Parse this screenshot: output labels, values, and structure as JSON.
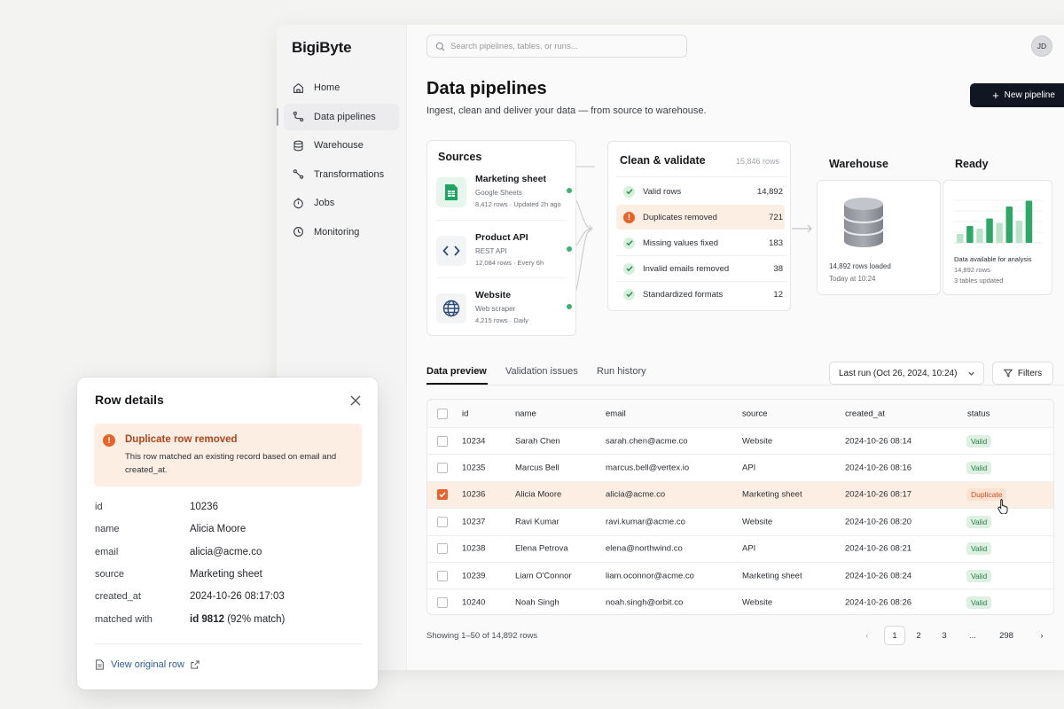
{
  "app": {
    "name": "BigiByte"
  },
  "nav": [
    {
      "label": "Home",
      "icon": "home-icon"
    },
    {
      "label": "Data pipelines",
      "icon": "pipeline-icon",
      "active": true
    },
    {
      "label": "Warehouse",
      "icon": "database-icon"
    },
    {
      "label": "Transformations",
      "icon": "transform-icon"
    },
    {
      "label": "Jobs",
      "icon": "jobs-icon"
    },
    {
      "label": "Monitoring",
      "icon": "monitoring-icon"
    }
  ],
  "search": {
    "placeholder": "Search pipelines, tables, or runs..."
  },
  "user": {
    "initials": "JD"
  },
  "page": {
    "title": "Data pipelines",
    "subtitle": "Ingest, clean and deliver your data — from source to warehouse.",
    "new_button": "New pipeline"
  },
  "sources": {
    "title": "Sources",
    "items": [
      {
        "name": "Marketing sheet",
        "type": "Google Sheets",
        "meta": "8,412 rows · Updated 2h ago",
        "icon": "sheets-icon"
      },
      {
        "name": "Product API",
        "type": "REST API",
        "meta": "12,084 rows · Every 6h",
        "icon": "code-icon"
      },
      {
        "name": "Website",
        "type": "Web scraper",
        "meta": "4,215 rows · Daily",
        "icon": "globe-icon"
      }
    ]
  },
  "clean": {
    "title": "Clean & validate",
    "count": "15,846 rows",
    "rows": [
      {
        "label": "Valid rows",
        "value": "14,892"
      },
      {
        "label": "Duplicates removed",
        "value": "721",
        "warn": true
      },
      {
        "label": "Missing values fixed",
        "value": "183"
      },
      {
        "label": "Invalid emails removed",
        "value": "38"
      },
      {
        "label": "Standardized formats",
        "value": "12"
      }
    ]
  },
  "warehouse": {
    "title": "Warehouse",
    "rows": "14,892 rows loaded",
    "time": "Today at 10:24"
  },
  "ready": {
    "title": "Ready",
    "line1": "Data available for analysis",
    "line2": "14,892 rows",
    "line3": "3 tables updated",
    "bars": [
      0.2,
      0.38,
      0.32,
      0.55,
      0.45,
      0.82,
      0.5,
      0.95
    ]
  },
  "tabs": [
    "Data preview",
    "Validation issues",
    "Run history"
  ],
  "run_select": "Last run (Oct 26, 2024, 10:24)",
  "filters_label": "Filters",
  "table": {
    "columns": [
      "id",
      "name",
      "email",
      "source",
      "created_at",
      "status"
    ],
    "rows": [
      [
        "10234",
        "Sarah Chen",
        "sarah.chen@acme.co",
        "Website",
        "2024-10-26 08:14",
        "Valid"
      ],
      [
        "10235",
        "Marcus Bell",
        "marcus.bell@vertex.io",
        "API",
        "2024-10-26 08:16",
        "Valid"
      ],
      [
        "10236",
        "Alicia Moore",
        "alicia@acme.co",
        "Marketing sheet",
        "2024-10-26 08:17",
        "Duplicate"
      ],
      [
        "10237",
        "Ravi Kumar",
        "ravi.kumar@acme.co",
        "Website",
        "2024-10-26 08:20",
        "Valid"
      ],
      [
        "10238",
        "Elena Petrova",
        "elena@northwind.co",
        "API",
        "2024-10-26 08:21",
        "Valid"
      ],
      [
        "10239",
        "Liam O'Connor",
        "liam.oconnor@acme.co",
        "Marketing sheet",
        "2024-10-26 08:24",
        "Valid"
      ],
      [
        "10240",
        "Noah Singh",
        "noah.singh@orbit.co",
        "Website",
        "2024-10-26 08:26",
        "Valid"
      ]
    ]
  },
  "footer": {
    "showing": "Showing 1–50 of 14,892 rows",
    "pages": [
      "1",
      "2",
      "3",
      "...",
      "298"
    ]
  },
  "details": {
    "title": "Row details",
    "alert_title": "Duplicate row removed",
    "alert_body": "This row matched an existing record based on email and created_at.",
    "fields": [
      {
        "key": "id",
        "value": "10236"
      },
      {
        "key": "name",
        "value": "Alicia Moore"
      },
      {
        "key": "email",
        "value": "alicia@acme.co"
      },
      {
        "key": "source",
        "value": "Marketing sheet"
      },
      {
        "key": "created_at",
        "value": "2024-10-26 08:17:03"
      },
      {
        "key": "matched with",
        "value": "id 9812",
        "suffix": " (92% match)"
      }
    ],
    "link": "View original row"
  },
  "colors": {
    "accent": "#e8632a",
    "valid": "#2f7a47",
    "primary": "#111722"
  }
}
